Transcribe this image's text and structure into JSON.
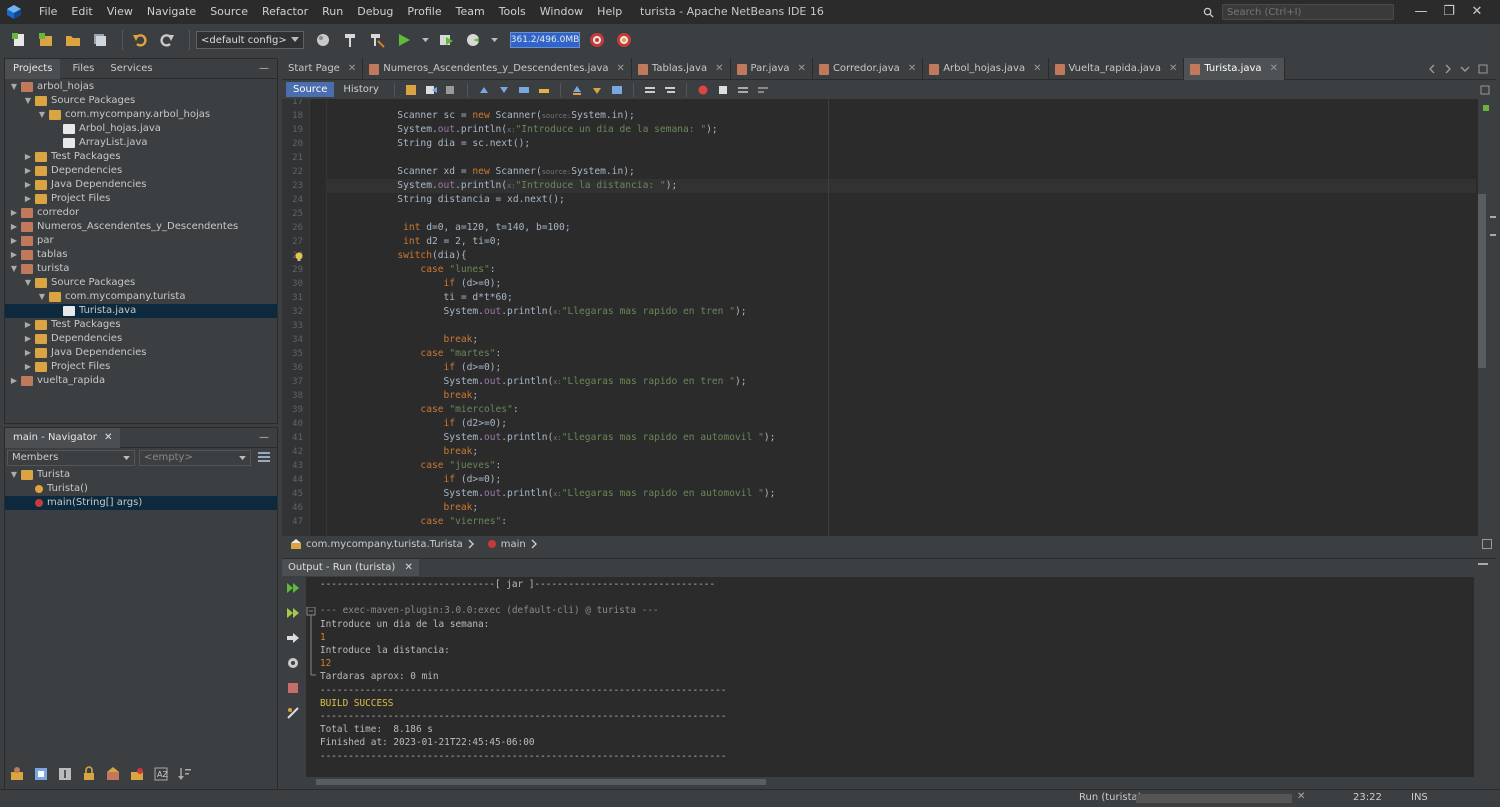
{
  "window": {
    "title": "turista - Apache NetBeans IDE 16",
    "search_placeholder": "Search (Ctrl+I)",
    "min_glyph": "—",
    "max_glyph": "❐",
    "close_glyph": "✕"
  },
  "menu": [
    "File",
    "Edit",
    "View",
    "Navigate",
    "Source",
    "Refactor",
    "Run",
    "Debug",
    "Profile",
    "Team",
    "Tools",
    "Window",
    "Help"
  ],
  "toolbar": {
    "config": "<default config>",
    "memory": "361.2/496.0MB"
  },
  "projects_panel": {
    "tabs": [
      "Projects",
      "Files",
      "Services"
    ],
    "minimize": "—",
    "tree": [
      {
        "label": "arbol_hojas",
        "indent": 0,
        "open": true,
        "icon": "project"
      },
      {
        "label": "Source Packages",
        "indent": 1,
        "open": true,
        "icon": "folder"
      },
      {
        "label": "com.mycompany.arbol_hojas",
        "indent": 2,
        "open": true,
        "icon": "package"
      },
      {
        "label": "Arbol_hojas.java",
        "indent": 3,
        "open": null,
        "icon": "java"
      },
      {
        "label": "ArrayList.java",
        "indent": 3,
        "open": null,
        "icon": "java"
      },
      {
        "label": "Test Packages",
        "indent": 1,
        "open": false,
        "icon": "folder"
      },
      {
        "label": "Dependencies",
        "indent": 1,
        "open": false,
        "icon": "folder"
      },
      {
        "label": "Java Dependencies",
        "indent": 1,
        "open": false,
        "icon": "folder"
      },
      {
        "label": "Project Files",
        "indent": 1,
        "open": false,
        "icon": "folder"
      },
      {
        "label": "corredor",
        "indent": 0,
        "open": false,
        "icon": "project"
      },
      {
        "label": "Numeros_Ascendentes_y_Descendentes",
        "indent": 0,
        "open": false,
        "icon": "project"
      },
      {
        "label": "par",
        "indent": 0,
        "open": false,
        "icon": "project"
      },
      {
        "label": "tablas",
        "indent": 0,
        "open": false,
        "icon": "project"
      },
      {
        "label": "turista",
        "indent": 0,
        "open": true,
        "icon": "project"
      },
      {
        "label": "Source Packages",
        "indent": 1,
        "open": true,
        "icon": "folder"
      },
      {
        "label": "com.mycompany.turista",
        "indent": 2,
        "open": true,
        "icon": "package"
      },
      {
        "label": "Turista.java",
        "indent": 3,
        "open": null,
        "icon": "java",
        "selected": true
      },
      {
        "label": "Test Packages",
        "indent": 1,
        "open": false,
        "icon": "folder"
      },
      {
        "label": "Dependencies",
        "indent": 1,
        "open": false,
        "icon": "folder"
      },
      {
        "label": "Java Dependencies",
        "indent": 1,
        "open": false,
        "icon": "folder"
      },
      {
        "label": "Project Files",
        "indent": 1,
        "open": false,
        "icon": "folder"
      },
      {
        "label": "vuelta_rapida",
        "indent": 0,
        "open": false,
        "icon": "project"
      }
    ]
  },
  "navigator_panel": {
    "title": "main - Navigator",
    "close": "✕",
    "minimize": "—",
    "filter": "Members",
    "scope": "<empty>",
    "tree": [
      {
        "label": "Turista",
        "indent": 0,
        "open": true,
        "icon": "class"
      },
      {
        "label": "Turista()",
        "indent": 1,
        "open": null,
        "icon": "constructor"
      },
      {
        "label": "main(String[] args)",
        "indent": 1,
        "open": null,
        "icon": "method",
        "selected": true
      }
    ]
  },
  "editor_tabs": [
    {
      "label": "Start Page",
      "active": false,
      "java": false
    },
    {
      "label": "Numeros_Ascendentes_y_Descendentes.java",
      "active": false,
      "java": true
    },
    {
      "label": "Tablas.java",
      "active": false,
      "java": true
    },
    {
      "label": "Par.java",
      "active": false,
      "java": true
    },
    {
      "label": "Corredor.java",
      "active": false,
      "java": true
    },
    {
      "label": "Arbol_hojas.java",
      "active": false,
      "java": true
    },
    {
      "label": "Vuelta_rapida.java",
      "active": false,
      "java": true
    },
    {
      "label": "Turista.java",
      "active": true,
      "java": true
    }
  ],
  "editor_toolbar": {
    "source": "Source",
    "history": "History"
  },
  "code": {
    "first_line": 17,
    "lines": [
      [],
      [
        [
          "            Scanner sc = ",
          ""
        ],
        [
          "new",
          "kw"
        ],
        [
          " Scanner(",
          ""
        ],
        [
          "source:",
          "hint"
        ],
        [
          "System.in);",
          ""
        ]
      ],
      [
        [
          "            System.",
          ""
        ],
        [
          "out",
          "fld"
        ],
        [
          ".println(",
          ""
        ],
        [
          "x:",
          "hint"
        ],
        [
          "\"Introduce un dia de la semana: \"",
          "str"
        ],
        [
          ");",
          ""
        ]
      ],
      [
        [
          "            String dia = sc.next();",
          ""
        ]
      ],
      [],
      [
        [
          "            Scanner xd = ",
          ""
        ],
        [
          "new",
          "kw"
        ],
        [
          " Scanner(",
          ""
        ],
        [
          "source:",
          "hint"
        ],
        [
          "System.in);",
          ""
        ]
      ],
      [
        [
          "            System.",
          ""
        ],
        [
          "out",
          "fld"
        ],
        [
          ".println(",
          ""
        ],
        [
          "x:",
          "hint"
        ],
        [
          "\"Introduce la distancia: \"",
          "str"
        ],
        [
          ");",
          ""
        ]
      ],
      [
        [
          "            String distancia = xd.next();",
          ""
        ]
      ],
      [],
      [
        [
          "             ",
          ""
        ],
        [
          "int",
          "kw"
        ],
        [
          " d=0, a=120, t=140, b=100;",
          ""
        ]
      ],
      [
        [
          "             ",
          ""
        ],
        [
          "int",
          "kw"
        ],
        [
          " d2 = 2, ti=0;",
          ""
        ]
      ],
      [
        [
          "            ",
          ""
        ],
        [
          "switch",
          "kw"
        ],
        [
          "(dia){",
          ""
        ]
      ],
      [
        [
          "                ",
          ""
        ],
        [
          "case",
          "kw"
        ],
        [
          " ",
          ""
        ],
        [
          "\"lunes\"",
          "str"
        ],
        [
          ":",
          ""
        ]
      ],
      [
        [
          "                    ",
          ""
        ],
        [
          "if",
          "kw"
        ],
        [
          " (d>=0);",
          ""
        ]
      ],
      [
        [
          "                    ti = d*t*60;",
          ""
        ]
      ],
      [
        [
          "                    System.",
          ""
        ],
        [
          "out",
          "fld"
        ],
        [
          ".println(",
          ""
        ],
        [
          "x:",
          "hint"
        ],
        [
          "\"Llegaras mas rapido en tren \"",
          "str"
        ],
        [
          ");",
          ""
        ]
      ],
      [],
      [
        [
          "                    ",
          ""
        ],
        [
          "break",
          "kw"
        ],
        [
          ";",
          ""
        ]
      ],
      [
        [
          "                ",
          ""
        ],
        [
          "case",
          "kw"
        ],
        [
          " ",
          ""
        ],
        [
          "\"martes\"",
          "str"
        ],
        [
          ":",
          ""
        ]
      ],
      [
        [
          "                    ",
          ""
        ],
        [
          "if",
          "kw"
        ],
        [
          " (d>=0);",
          ""
        ]
      ],
      [
        [
          "                    System.",
          ""
        ],
        [
          "out",
          "fld"
        ],
        [
          ".println(",
          ""
        ],
        [
          "x:",
          "hint"
        ],
        [
          "\"Llegaras mas rapido en tren \"",
          "str"
        ],
        [
          ");",
          ""
        ]
      ],
      [
        [
          "                    ",
          ""
        ],
        [
          "break",
          "kw"
        ],
        [
          ";",
          ""
        ]
      ],
      [
        [
          "                ",
          ""
        ],
        [
          "case",
          "kw"
        ],
        [
          " ",
          ""
        ],
        [
          "\"miercoles\"",
          "str"
        ],
        [
          ":",
          ""
        ]
      ],
      [
        [
          "                    ",
          ""
        ],
        [
          "if",
          "kw"
        ],
        [
          " (d2>=0);",
          ""
        ]
      ],
      [
        [
          "                    System.",
          ""
        ],
        [
          "out",
          "fld"
        ],
        [
          ".println(",
          ""
        ],
        [
          "x:",
          "hint"
        ],
        [
          "\"Llegaras mas rapido en automovil \"",
          "str"
        ],
        [
          ");",
          ""
        ]
      ],
      [
        [
          "                    ",
          ""
        ],
        [
          "break",
          "kw"
        ],
        [
          ";",
          ""
        ]
      ],
      [
        [
          "                ",
          ""
        ],
        [
          "case",
          "kw"
        ],
        [
          " ",
          ""
        ],
        [
          "\"jueves\"",
          "str"
        ],
        [
          ":",
          ""
        ]
      ],
      [
        [
          "                    ",
          ""
        ],
        [
          "if",
          "kw"
        ],
        [
          " (d>=0);",
          ""
        ]
      ],
      [
        [
          "                    System.",
          ""
        ],
        [
          "out",
          "fld"
        ],
        [
          ".println(",
          ""
        ],
        [
          "x:",
          "hint"
        ],
        [
          "\"Llegaras mas rapido en automovil \"",
          "str"
        ],
        [
          ");",
          ""
        ]
      ],
      [
        [
          "                    ",
          ""
        ],
        [
          "break",
          "kw"
        ],
        [
          ";",
          ""
        ]
      ],
      [
        [
          "                ",
          ""
        ],
        [
          "case",
          "kw"
        ],
        [
          " ",
          ""
        ],
        [
          "\"viernes\"",
          "str"
        ],
        [
          ":",
          ""
        ]
      ]
    ]
  },
  "breadcrumb": {
    "class": "com.mycompany.turista.Turista",
    "method": "main"
  },
  "output": {
    "title": "Output - Run (turista)",
    "close": "✕",
    "lines": [
      {
        "text": "-------------------------------[ jar ]--------------------------------",
        "style": ""
      },
      {
        "text": "",
        "style": ""
      },
      {
        "text": "--- exec-maven-plugin:3.0.0:exec (default-cli) @ turista ---",
        "style": "gray"
      },
      {
        "text": "Introduce un dia de la semana:",
        "style": ""
      },
      {
        "text": "1",
        "style": "orange"
      },
      {
        "text": "Introduce la distancia:",
        "style": ""
      },
      {
        "text": "12",
        "style": "orange"
      },
      {
        "text": "Tardaras aprox: 0 min",
        "style": ""
      },
      {
        "text": "------------------------------------------------------------------------",
        "style": ""
      },
      {
        "text": "BUILD SUCCESS",
        "style": "yellow"
      },
      {
        "text": "------------------------------------------------------------------------",
        "style": ""
      },
      {
        "text": "Total time:  8.186 s",
        "style": ""
      },
      {
        "text": "Finished at: 2023-01-21T22:45:45-06:00",
        "style": ""
      },
      {
        "text": "------------------------------------------------------------------------",
        "style": ""
      }
    ]
  },
  "status": {
    "task": "Run (turista)",
    "position": "23:22",
    "mode": "INS"
  }
}
